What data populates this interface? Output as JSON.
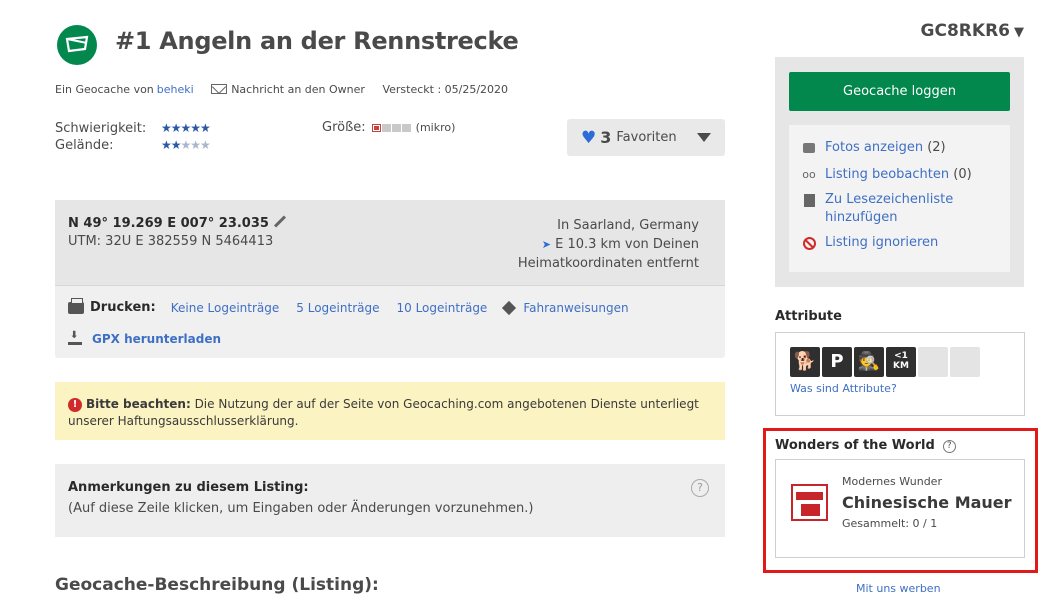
{
  "header": {
    "title": "#1 Angeln an der Rennstrecke",
    "gc_code": "GC8RKR6",
    "gc_caret": "▼"
  },
  "byline": {
    "prefix": "Ein Geocache von",
    "owner": "beheki",
    "message": "Nachricht an den Owner",
    "hidden": "Versteckt : 05/25/2020"
  },
  "ratings": {
    "difficulty_label": "Schwierigkeit:",
    "difficulty_stars": "★★★★★",
    "terrain_label": "Gelände:",
    "terrain_stars_on": "★★",
    "terrain_stars_off": "★★★",
    "size_label": "Größe:",
    "size_value": "(mikro)"
  },
  "favorites": {
    "count": "3",
    "label": "Favoriten"
  },
  "coordinates": {
    "coords": "N 49° 19.269 E 007° 23.035",
    "utm": "UTM: 32U E 382559 N 5464413",
    "location": "In Saarland, Germany",
    "distance": "E 10.3 km von Deinen",
    "distance_suffix": "Heimatkoordinaten entfernt"
  },
  "print": {
    "label": "Drucken:",
    "no_logs": "Keine Logeinträge",
    "five_logs": "5 Logeinträge",
    "ten_logs": "10 Logeinträge",
    "directions": "Fahranweisungen",
    "gpx": "GPX herunterladen"
  },
  "notice": {
    "bold": "Bitte beachten:",
    "text": " Die Nutzung der auf der Seite von Geocaching.com angebotenen Dienste unterliegt unserer Haftungsausschlusserklärung."
  },
  "notes": {
    "title": "Anmerkungen zu diesem Listing:",
    "hint": "(Auf diese Zeile klicken, um Eingaben oder Änderungen vorzunehmen.)"
  },
  "description_title": "Geocache-Beschreibung (Listing):",
  "sidebar": {
    "log_button": "Geocache loggen",
    "links": [
      {
        "label": "Fotos anzeigen",
        "count": " (2)"
      },
      {
        "label": "Listing beobachten",
        "count": " (0)"
      },
      {
        "label": "Zu Lesezeichenliste hinzufügen",
        "count": ""
      },
      {
        "label": "Listing ignorieren",
        "count": ""
      }
    ],
    "attributes_title": "Attribute",
    "attributes_link": "Was sind Attribute?",
    "attr_km": "<1 KM",
    "wow_title": "Wonders of the World",
    "wow_sub": "Modernes Wunder",
    "wow_name": "Chinesische Mauer",
    "wow_count": "Gesammelt: 0 / 1",
    "promo": "Mit uns werben"
  },
  "colors": {
    "brand_green": "#02874d",
    "link_blue": "#3f6fc4",
    "highlight_red": "#e0191b"
  }
}
